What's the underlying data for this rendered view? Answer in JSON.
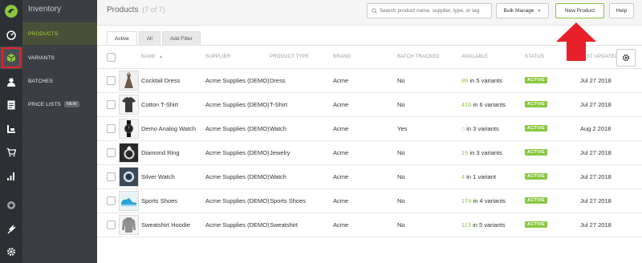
{
  "app": {
    "section_title": "Inventory"
  },
  "rail": {
    "icons": [
      "logo-icon",
      "dashboard-icon",
      "inventory-box-icon",
      "user-icon",
      "document-icon",
      "production-icon",
      "cart-icon",
      "chart-icon",
      "record-icon",
      "plugin-icon",
      "gear-icon"
    ]
  },
  "nav": {
    "items": [
      {
        "label": "PRODUCTS"
      },
      {
        "label": "VARIANTS"
      },
      {
        "label": "BATCHES"
      },
      {
        "label": "PRICE LISTS",
        "badge": "NEW"
      }
    ]
  },
  "header": {
    "title": "Products",
    "count": "(7 of 7)",
    "search_placeholder": "Search product name, supplier, type, or tag",
    "bulk_label": "Bulk Manage",
    "new_label": "New Product",
    "help_label": "Help"
  },
  "tabs": [
    {
      "label": "Active",
      "active": true
    },
    {
      "label": "All"
    },
    {
      "label": "Add Filter"
    }
  ],
  "columns": {
    "name": "NAME",
    "sort_indicator": "▲",
    "supplier": "SUPPLIER",
    "type": "PRODUCT TYPE",
    "brand": "BRAND",
    "batch": "BATCH TRACKED",
    "available": "AVAILABLE",
    "status": "STATUS",
    "updated": "LAST UPDATED"
  },
  "rows": [
    {
      "name": "Cocktail Dress",
      "supplier": "Acme Supplies (DEMO)",
      "type": "Dress",
      "brand": "Acme",
      "batch": "No",
      "avail_num": "89",
      "avail_text": "in 5 variants",
      "status": "ACTIVE",
      "date": "Jul 27 2018",
      "thumb": "dress"
    },
    {
      "name": "Cotton T-Shirt",
      "supplier": "Acme Supplies (DEMO)",
      "type": "T-Shirt",
      "brand": "Acme",
      "batch": "No",
      "avail_num": "416",
      "avail_text": "in 6 variants",
      "status": "ACTIVE",
      "date": "Jul 27 2018",
      "thumb": "tshirt"
    },
    {
      "name": "Demo Analog Watch",
      "supplier": "Acme Supplies (DEMO)",
      "type": "Watch",
      "brand": "Acme",
      "batch": "Yes",
      "avail_num": "0",
      "avail_text": "in 3 variants",
      "status": "ACTIVE",
      "date": "Aug 2 2018",
      "thumb": "watch"
    },
    {
      "name": "Diamond Ring",
      "supplier": "Acme Supplies (DEMO)",
      "type": "Jewelry",
      "brand": "Acme",
      "batch": "No",
      "avail_num": "19",
      "avail_text": "in 3 variants",
      "status": "ACTIVE",
      "date": "Jul 27 2018",
      "thumb": "ring"
    },
    {
      "name": "Silver Watch",
      "supplier": "Acme Supplies (DEMO)",
      "type": "Watch",
      "brand": "Acme",
      "batch": "No",
      "avail_num": "4",
      "avail_text": "in 1 variant",
      "status": "ACTIVE",
      "date": "Jul 27 2018",
      "thumb": "silverwatch"
    },
    {
      "name": "Sports Shoes",
      "supplier": "Acme Supplies (DEMO)",
      "type": "Sports Shoes",
      "brand": "Acme",
      "batch": "No",
      "avail_num": "174",
      "avail_text": "in 4 variants",
      "status": "ACTIVE",
      "date": "Jul 27 2018",
      "thumb": "shoes"
    },
    {
      "name": "Sweatshirt Hoodie",
      "supplier": "Acme Supplies (DEMO)",
      "type": "Sweatshirt",
      "brand": "Acme",
      "batch": "No",
      "avail_num": "113",
      "avail_text": "in 5 variants",
      "status": "ACTIVE",
      "date": "Jul 27 2018",
      "thumb": "hoodie"
    }
  ],
  "colors": {
    "accent_green": "#8cc63f",
    "sidebar_dark": "#2c2f33",
    "nav_bg": "#3b3e43",
    "annotation_red": "#e8202a"
  },
  "annotation": {
    "type": "arrow-up",
    "target": "new-product-button",
    "color": "#e8202a"
  }
}
